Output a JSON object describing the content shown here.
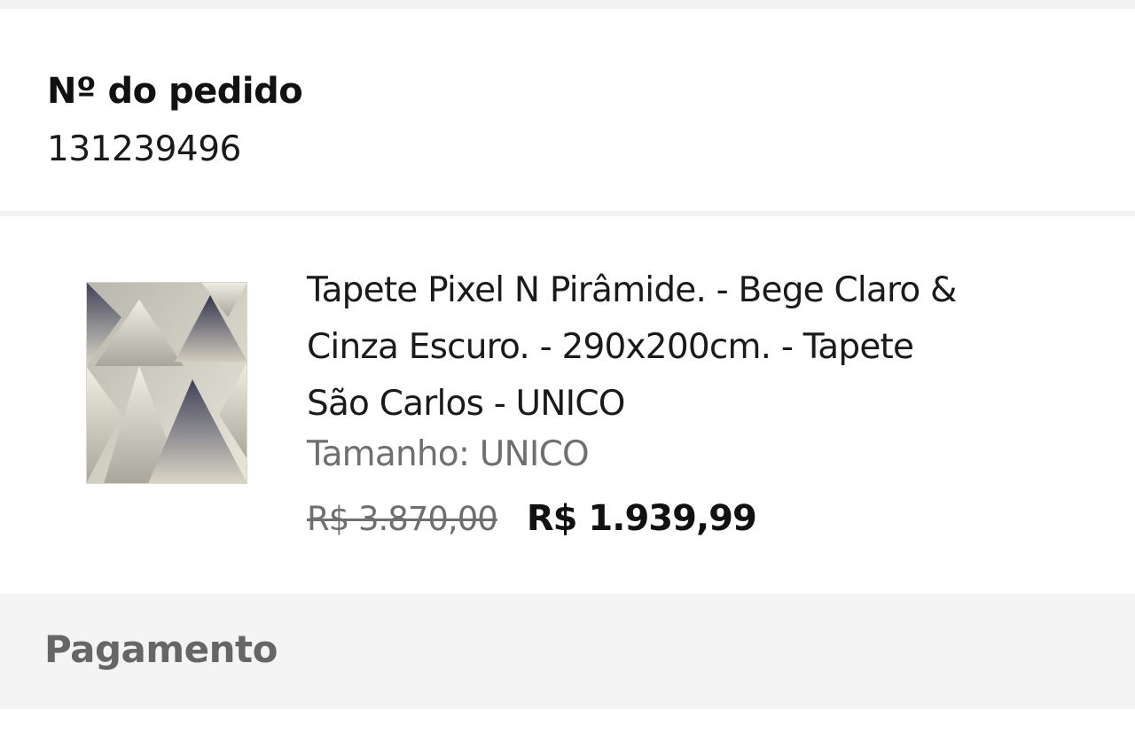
{
  "order": {
    "label": "Nº do pedido",
    "number": "131239496"
  },
  "product": {
    "title_lines": [
      "Tapete Pixel N Pirâmide. - Bege Claro &",
      "Cinza Escuro. - 290x200cm. - Tapete",
      "São Carlos - UNICO"
    ],
    "size": "Tamanho: UNICO",
    "price_old": "R$ 3.870,00",
    "price_new": "R$ 1.939,99",
    "image_icon": "rug-pyramid-pattern-image"
  },
  "payment": {
    "title": "Pagamento"
  },
  "colors": {
    "background": "#f4f4f4",
    "card": "#ffffff",
    "text_primary": "#111111",
    "text_secondary": "#6f6f6f",
    "rug_light": "#e6e3d6",
    "rug_dark": "#4a4a5e"
  }
}
